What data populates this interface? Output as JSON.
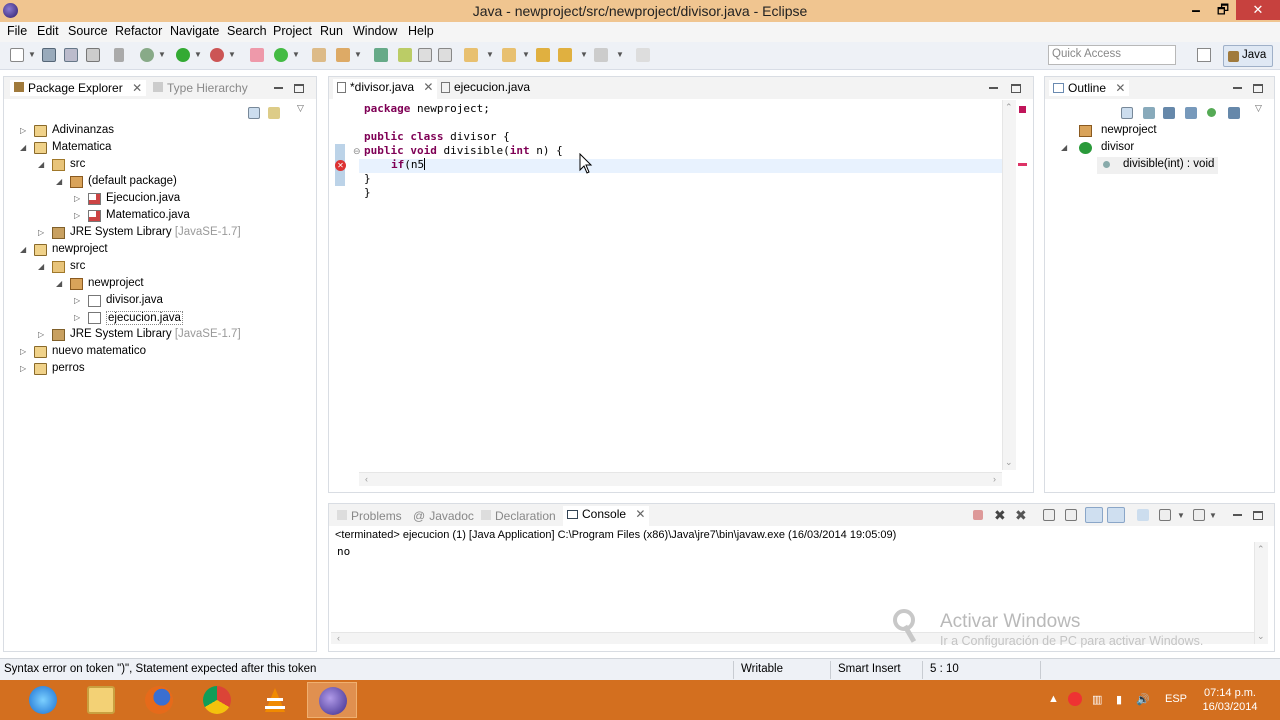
{
  "window": {
    "title": "Java - newproject/src/newproject/divisor.java - Eclipse",
    "min": "🗕",
    "max": "🗗",
    "close": "✕"
  },
  "menu": [
    "File",
    "Edit",
    "Source",
    "Refactor",
    "Navigate",
    "Search",
    "Project",
    "Run",
    "Window",
    "Help"
  ],
  "quick_access": {
    "placeholder": "Quick Access"
  },
  "perspective": {
    "label": "Java"
  },
  "package_explorer": {
    "tabs": [
      "Package Explorer",
      "Type Hierarchy"
    ],
    "tree": [
      {
        "label": "Adivinanzas",
        "expanded": false,
        "icon": "project-icon"
      },
      {
        "label": "Matematica",
        "expanded": true,
        "icon": "project-icon"
      },
      {
        "label": "src",
        "expanded": true,
        "icon": "source-folder-icon"
      },
      {
        "label": "(default package)",
        "expanded": true,
        "icon": "package-icon"
      },
      {
        "label": "Ejecucion.java",
        "expanded": false,
        "icon": "java-file-icon"
      },
      {
        "label": "Matematico.java",
        "expanded": false,
        "icon": "java-file-icon"
      },
      {
        "label": "JRE System Library",
        "suffix": "[JavaSE-1.7]",
        "expanded": false,
        "icon": "library-icon"
      },
      {
        "label": "newproject",
        "expanded": true,
        "icon": "project-icon"
      },
      {
        "label": "src",
        "expanded": true,
        "icon": "source-folder-icon"
      },
      {
        "label": "newproject",
        "expanded": true,
        "icon": "package-icon"
      },
      {
        "label": "divisor.java",
        "expanded": false,
        "icon": "java-file-icon"
      },
      {
        "label": "ejecucion.java",
        "expanded": false,
        "icon": "java-file-icon"
      },
      {
        "label": "JRE System Library",
        "suffix": "[JavaSE-1.7]",
        "expanded": false,
        "icon": "library-icon"
      },
      {
        "label": "nuevo matematico",
        "expanded": false,
        "icon": "project-icon"
      },
      {
        "label": "perros",
        "expanded": false,
        "icon": "project-icon"
      }
    ]
  },
  "editor": {
    "tabs": [
      "*divisor.java",
      "ejecucion.java"
    ],
    "lines": {
      "l1_kw": "package",
      "l1_rest": " newproject;",
      "l3_kw1": "public",
      "l3_kw2": "class",
      "l3_rest": " divisor {",
      "l4_kw1": "public",
      "l4_kw2": "void",
      "l4_mid": " divisible(",
      "l4_kw3": "int",
      "l4_rest": " n) {",
      "l5_kw": "if",
      "l5_rest": "(n5",
      "l6": "}",
      "l7": "}"
    }
  },
  "outline": {
    "tab": "Outline",
    "items": [
      "newproject",
      "divisor",
      "divisible(int) : void"
    ]
  },
  "bottom": {
    "tabs": [
      "Problems",
      "Javadoc",
      "Declaration",
      "Console"
    ],
    "console_header": "<terminated> ejecucion (1) [Java Application] C:\\Program Files (x86)\\Java\\jre7\\bin\\javaw.exe (16/03/2014 19:05:09)",
    "console_output": "no"
  },
  "watermark": {
    "title": "Activar Windows",
    "subtitle": "Ir a Configuración de PC para activar Windows."
  },
  "status": {
    "message": "Syntax error on token \")\", Statement expected after this token",
    "writable": "Writable",
    "insert_mode": "Smart Insert",
    "position": "5 : 10"
  },
  "taskbar": {
    "lang": "ESP",
    "time": "07:14 p.m.",
    "date": "16/03/2014"
  }
}
